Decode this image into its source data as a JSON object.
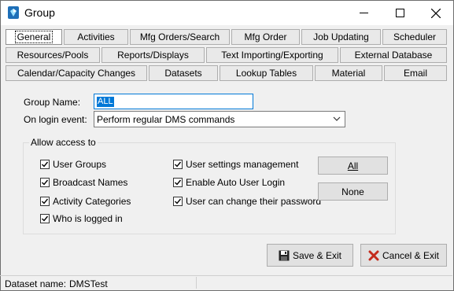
{
  "window": {
    "title": "Group"
  },
  "tabs": {
    "row1": [
      "General",
      "Activities",
      "Mfg Orders/Search",
      "Mfg Order",
      "Job Updating",
      "Scheduler"
    ],
    "row2": [
      "Resources/Pools",
      "Reports/Displays",
      "Text Importing/Exporting",
      "External Database"
    ],
    "row3": [
      "Calendar/Capacity Changes",
      "Datasets",
      "Lookup Tables",
      "Material",
      "Email"
    ]
  },
  "form": {
    "group_name_label": "Group Name:",
    "group_name_value": "ALL",
    "login_event_label": "On login event:",
    "login_event_value": "Perform regular DMS commands"
  },
  "access": {
    "title": "Allow access to",
    "col1": [
      "User Groups",
      "Broadcast Names",
      "Activity Categories",
      "Who is logged in"
    ],
    "col2": [
      "User settings management",
      "Enable Auto User Login",
      "User can change their password"
    ],
    "all_label": "All",
    "none_label": "None"
  },
  "actions": {
    "save_label": "Save & Exit",
    "cancel_label": "Cancel & Exit"
  },
  "status": {
    "dataset_label": "Dataset name:",
    "dataset_value": "DMSTest"
  },
  "colors": {
    "accent": "#0078d7",
    "cancel_x": "#c42b1c"
  }
}
